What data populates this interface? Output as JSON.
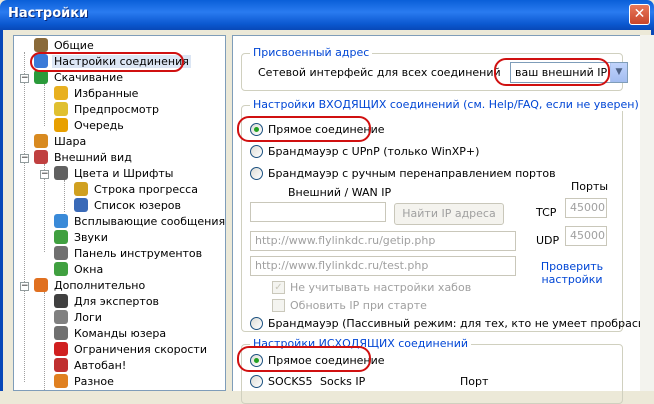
{
  "window": {
    "title": "Настройки",
    "close_label": "✕"
  },
  "tree": [
    {
      "label": "Общие",
      "icon": "general-icon",
      "color": "#8a6a3a"
    },
    {
      "label": "Настройки соединения",
      "icon": "connection-icon",
      "color": "#3a7ad8"
    },
    {
      "label": "Скачивание",
      "icon": "download-icon",
      "color": "#2a9a3a"
    },
    {
      "label": "Избранные",
      "icon": "favorites-icon",
      "color": "#e8b020"
    },
    {
      "label": "Предпросмотр",
      "icon": "preview-icon",
      "color": "#e0c030"
    },
    {
      "label": "Очередь",
      "icon": "queue-icon",
      "color": "#e8a000"
    },
    {
      "label": "Шара",
      "icon": "share-icon",
      "color": "#d88a20"
    },
    {
      "label": "Внешний вид",
      "icon": "appearance-icon",
      "color": "#c04040"
    },
    {
      "label": "Цвета и Шрифты",
      "icon": "colors-fonts-icon",
      "color": "#606060"
    },
    {
      "label": "Строка прогресса",
      "icon": "progress-bar-icon",
      "color": "#d0a020"
    },
    {
      "label": "Список юзеров",
      "icon": "user-list-icon",
      "color": "#3a6ab8"
    },
    {
      "label": "Всплывающие сообщения",
      "icon": "popup-icon",
      "color": "#3a8ad8"
    },
    {
      "label": "Звуки",
      "icon": "sounds-icon",
      "color": "#40a040"
    },
    {
      "label": "Панель инструментов",
      "icon": "toolbar-icon",
      "color": "#707070"
    },
    {
      "label": "Окна",
      "icon": "windows-icon",
      "color": "#40a040"
    },
    {
      "label": "Дополнительно",
      "icon": "advanced-icon",
      "color": "#e07020"
    },
    {
      "label": "Для экспертов",
      "icon": "experts-icon",
      "color": "#404040"
    },
    {
      "label": "Логи",
      "icon": "logs-icon",
      "color": "#808080"
    },
    {
      "label": "Команды юзера",
      "icon": "user-commands-icon",
      "color": "#707070"
    },
    {
      "label": "Ограничения скорости",
      "icon": "speed-limit-icon",
      "color": "#d02020"
    },
    {
      "label": "Автобан!",
      "icon": "autoban-icon",
      "color": "#c03030"
    },
    {
      "label": "Разное",
      "icon": "misc-icon",
      "color": "#e08020"
    }
  ],
  "assigned": {
    "legend": "Присвоенный адрес",
    "iface_label": "Сетевой интерфейс для всех соединений",
    "iface_value": "ваш внешний IP"
  },
  "incoming": {
    "legend": "Настройки ВХОДЯЩИХ соединений (см. Help/FAQ, если не уверен)",
    "opt_direct": "Прямое соединение",
    "opt_upnp": "Брандмауэр с UPnP (только WinXP+)",
    "opt_manual": "Брандмауэр с ручным перенаправлением портов",
    "wan_label": "Внешний / WAN IP",
    "ports_label": "Порты",
    "find_ip_button": "Найти IP адреса",
    "tcp_label": "TCP",
    "tcp_value": "45000",
    "udp_label": "UDP",
    "udp_value": "45000",
    "url1": "http://www.flylinkdc.ru/getip.php",
    "url2": "http://www.flylinkdc.ru/test.php",
    "check_settings_link": "Проверить настройки",
    "ignore_hubs": "Не учитывать настройки хабов",
    "update_ip": "Обновить IP при старте",
    "opt_passive": "Брандмауэр (Пассивный режим: для тех, кто не умеет пробрасывать"
  },
  "outgoing": {
    "legend": "Настройки ИСХОДЯЩИХ соединений",
    "opt_direct": "Прямое соединение",
    "opt_socks": "SOCKS5",
    "socks_ip": "Socks IP",
    "port": "Порт"
  },
  "colors": {
    "highlight_oval": "#d01010",
    "legend_blue": "#0046d5"
  }
}
